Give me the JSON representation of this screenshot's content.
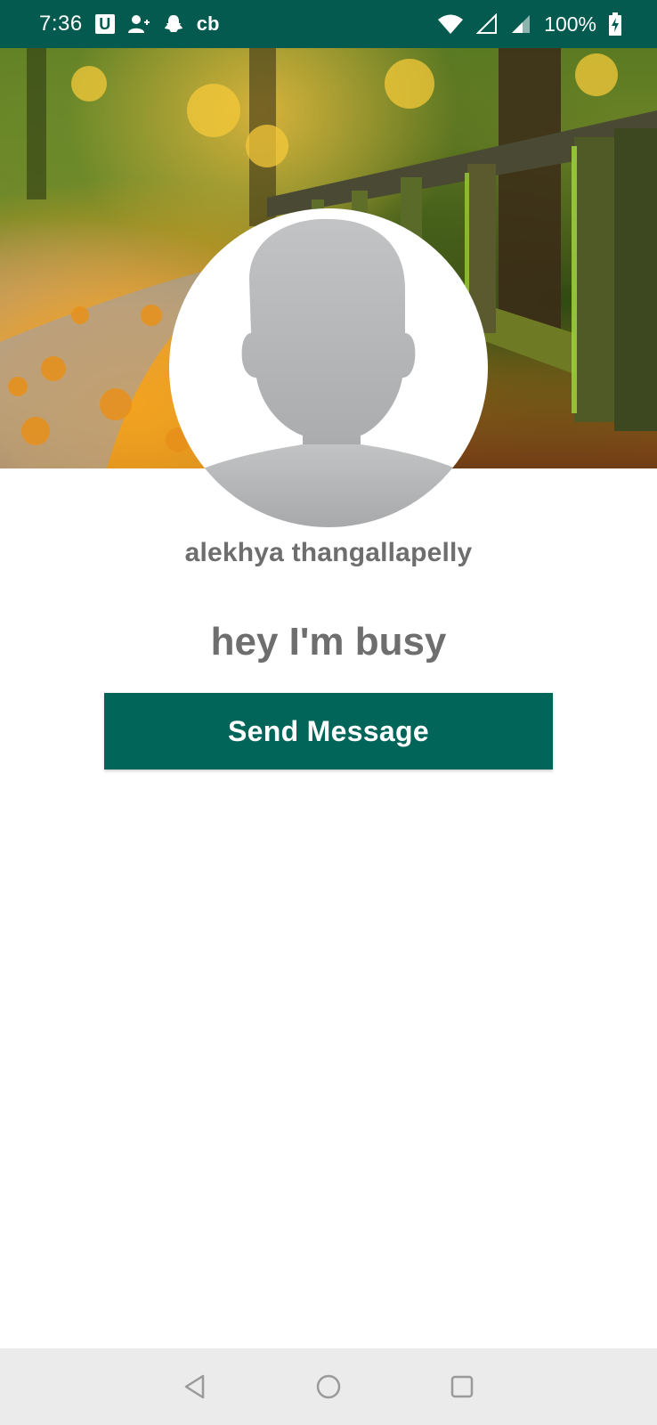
{
  "status_bar": {
    "time": "7:36",
    "left_icons": [
      "u-app-icon",
      "person-add-icon",
      "snapchat-icon"
    ],
    "cb_label": "cb",
    "right_icons": [
      "wifi-icon",
      "signal-empty-icon",
      "signal-icon",
      "battery-charging-icon"
    ],
    "battery": "100%",
    "background_color": "#045a4f"
  },
  "profile": {
    "cover_image": "autumn-forest-path-with-fence",
    "avatar": "default-person-silhouette",
    "name": "alekhya thangallapelly",
    "status": "hey I'm busy"
  },
  "actions": {
    "send_message_label": "Send Message",
    "button_color": "#02655a"
  },
  "nav_bar": {
    "buttons": [
      "back-icon",
      "home-icon",
      "recents-icon"
    ]
  }
}
